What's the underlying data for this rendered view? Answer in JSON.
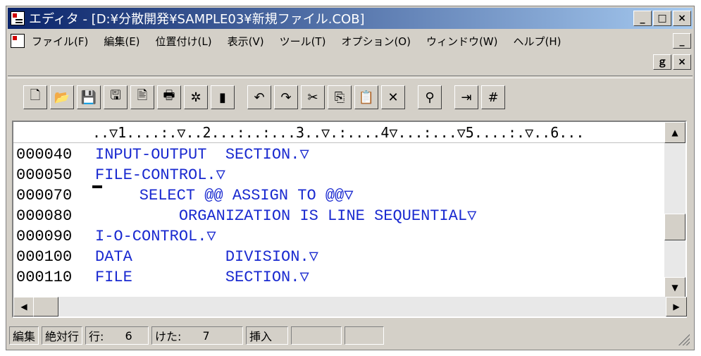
{
  "window": {
    "title": "エディタ - [D:¥分散開発¥SAMPLE03¥新規ファイル.COB]"
  },
  "menu": [
    "ファイル(F)",
    "編集(E)",
    "位置付け(L)",
    "表示(V)",
    "ツール(T)",
    "オプション(O)",
    "ウィンドウ(W)",
    "ヘルプ(H)"
  ],
  "caption_buttons": {
    "minimize": "_",
    "maximize": "□",
    "close": "×",
    "restore": "ｇ"
  },
  "toolbar": [
    {
      "name": "new-icon",
      "glyph": "🗋"
    },
    {
      "name": "open-icon",
      "glyph": "📂"
    },
    {
      "name": "save-icon",
      "glyph": "💾"
    },
    {
      "name": "save-all-icon",
      "glyph": "🖫"
    },
    {
      "name": "print-preview-icon",
      "glyph": "🖹"
    },
    {
      "name": "print-icon",
      "glyph": "🖶"
    },
    {
      "name": "settings-icon",
      "glyph": "✲"
    },
    {
      "name": "bookmark-icon",
      "glyph": "▮"
    },
    {
      "name": "undo-icon",
      "glyph": "↶"
    },
    {
      "name": "redo-icon",
      "glyph": "↷"
    },
    {
      "name": "cut-icon",
      "glyph": "✂"
    },
    {
      "name": "copy-icon",
      "glyph": "⎘"
    },
    {
      "name": "paste-icon",
      "glyph": "📋"
    },
    {
      "name": "delete-icon",
      "glyph": "✕"
    },
    {
      "name": "find-icon",
      "glyph": "⚲"
    },
    {
      "name": "insert-line-icon",
      "glyph": "⇥"
    },
    {
      "name": "line-number-icon",
      "glyph": "#"
    }
  ],
  "ruler": "..▽1....:.▽..2...:..:...3..▽.:....4▽...:...▽5....:.▽..6...",
  "lines": [
    {
      "num": "000040",
      "text": "INPUT-OUTPUT  SECTION.▽"
    },
    {
      "num": "000050",
      "text": "FILE-CONTROL.▽"
    },
    {
      "num": "000070",
      "text": "    SELECT @@ ASSIGN TO @@▽",
      "cursor": true
    },
    {
      "num": "000080",
      "text": "         ORGANIZATION IS LINE SEQUENTIAL▽"
    },
    {
      "num": "000090",
      "text": "I-O-CONTROL.▽"
    },
    {
      "num": "000100",
      "text": "DATA          DIVISION.▽"
    },
    {
      "num": "000110",
      "text": "FILE          SECTION.▽"
    }
  ],
  "statusbar": {
    "mode": "編集",
    "line_kind": "絶対行",
    "row_label": "行:",
    "row_value": "6",
    "col_label": "けた:",
    "col_value": "7",
    "insert": "挿入"
  }
}
